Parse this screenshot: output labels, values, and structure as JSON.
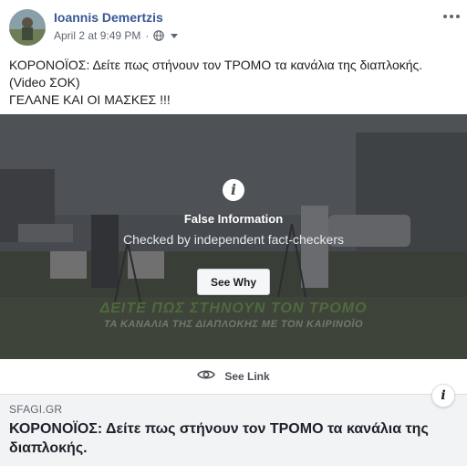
{
  "post": {
    "author": "Ioannis Demertzis",
    "timestamp": "April 2 at 9:49 PM",
    "separator": "·",
    "privacy_icon": "globe-icon",
    "text_lines": [
      "ΚΟΡΟΝΟΪΟΣ: Δείτε πως στήνουν τον ΤΡΟΜΟ τα κανάλια της διαπλοκής.",
      "(Video ΣΟΚ)",
      "ΓΕΛΑΝΕ ΚΑΙ ΟΙ ΜΑΣΚΕΣ !!!"
    ]
  },
  "media": {
    "warning_title": "False Information",
    "warning_subtitle": "Checked by independent fact-checkers",
    "see_why_label": "See Why",
    "banner_line1": "ΔΕΙΤΕ ΠΩΣ ΣΤΗΝΟΥΝ ΤΟΝ ΤΡΟΜΟ",
    "banner_line2": "ΤΑ ΚΑΝΑΛΙΑ ΤΗΣ ΔΙΑΠΛΟΚΗΣ ΜΕ ΤΟΝ ΚΑΙΡΙΝΟΪΟ"
  },
  "see_link": {
    "label": "See Link",
    "icon": "eye-icon"
  },
  "link_preview": {
    "domain": "SFAGI.GR",
    "title": "ΚΟΡΟΝΟΪΟΣ: Δείτε πως στήνουν τον ΤΡΟΜΟ τα κανάλια της διαπλοκής."
  },
  "colors": {
    "author_link": "#385898",
    "text": "#1c1e21",
    "meta": "#606770",
    "preview_bg": "#f2f3f5"
  }
}
